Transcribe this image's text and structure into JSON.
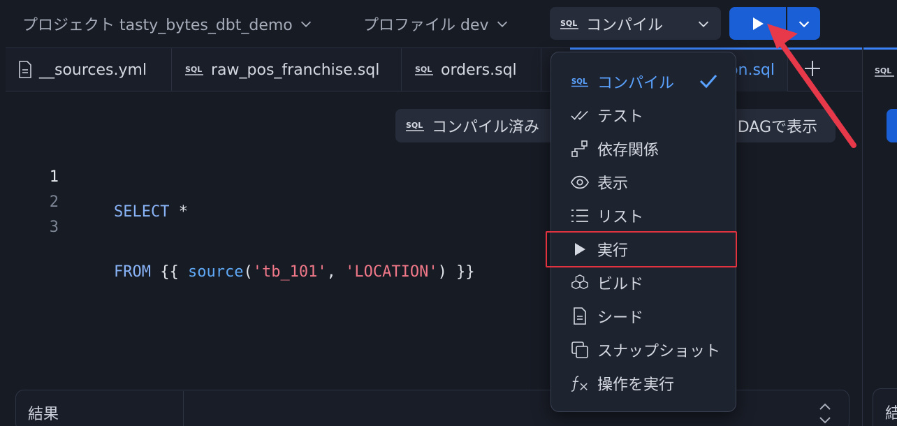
{
  "toolbar": {
    "project_label": "プロジェクト tasty_bytes_dbt_demo",
    "profile_label": "プロファイル dev",
    "compile_label": "コンパイル"
  },
  "tabs": [
    {
      "label": "__sources.yml",
      "icon": "file-icon"
    },
    {
      "label": "raw_pos_franchise.sql",
      "icon": "sql-icon"
    },
    {
      "label": "orders.sql",
      "icon": "sql-icon"
    },
    {
      "label": "on.sql",
      "icon": "sql-icon"
    }
  ],
  "chip": {
    "left_label": "コンパイル済み",
    "right_label": "DAGで表示"
  },
  "editor": {
    "lines": [
      {
        "number": "1",
        "parts": [
          {
            "t": "SELECT",
            "c": "kw"
          },
          {
            "t": " *",
            "c": "plain"
          }
        ]
      },
      {
        "number": "2",
        "parts": [
          {
            "t": "FROM",
            "c": "kw"
          },
          {
            "t": " {{ ",
            "c": "plain"
          },
          {
            "t": "source",
            "c": "fn"
          },
          {
            "t": "(",
            "c": "plain"
          },
          {
            "t": "'tb_101'",
            "c": "str"
          },
          {
            "t": ", ",
            "c": "plain"
          },
          {
            "t": "'LOCATION'",
            "c": "str"
          },
          {
            "t": ") }}",
            "c": "plain"
          }
        ]
      },
      {
        "number": "3",
        "parts": []
      }
    ]
  },
  "results": {
    "label": "結果"
  },
  "menu": {
    "items": [
      {
        "label": "コンパイル",
        "icon": "sql-icon",
        "selected": true
      },
      {
        "label": "テスト",
        "icon": "double-check-icon"
      },
      {
        "label": "依存関係",
        "icon": "dependency-icon"
      },
      {
        "label": "表示",
        "icon": "eye-icon"
      },
      {
        "label": "リスト",
        "icon": "list-icon"
      },
      {
        "label": "実行",
        "icon": "play-icon",
        "highlighted": true
      },
      {
        "label": "ビルド",
        "icon": "cubes-icon"
      },
      {
        "label": "シード",
        "icon": "document-icon"
      },
      {
        "label": "スナップショット",
        "icon": "copy-icon"
      },
      {
        "label": "操作を実行",
        "icon": "function-icon"
      }
    ]
  },
  "right_panel": {
    "label": "結"
  },
  "colors": {
    "background": "#171b24",
    "accent": "#1a5fd6",
    "highlight": "#e0323f",
    "string": "#f07888",
    "keyword": "#8ab4f8"
  }
}
